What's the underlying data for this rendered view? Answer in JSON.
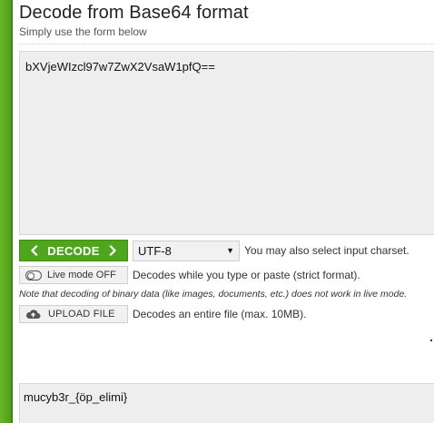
{
  "header": {
    "title": "Decode from Base64 format",
    "subtitle": "Simply use the form below"
  },
  "input": {
    "value": "bXVjeWIzcl97w7ZwX2VsaW1pfQ=="
  },
  "decode_row": {
    "decode_label": "DECODE",
    "charset_value": "UTF-8",
    "charset_helper": "You may also select input charset."
  },
  "live_row": {
    "live_label": "Live mode OFF",
    "live_helper": "Decodes while you type or paste (strict format)."
  },
  "note": "Note that decoding of binary data (like images, documents, etc.) does not work in live mode.",
  "upload_row": {
    "upload_label": "UPLOAD FILE",
    "upload_helper": "Decodes an entire file (max. 10MB)."
  },
  "output": {
    "value": "mucyb3r_{öp_elimi}"
  },
  "colors": {
    "accent_green": "#4fa61c",
    "edge_green": "#5aa51f",
    "field_bg": "#eeeeee"
  },
  "icons": [
    "chevron-left-icon",
    "chevron-right-icon",
    "toggle-icon",
    "cloud-upload-icon",
    "dropdown-arrow-icon"
  ]
}
